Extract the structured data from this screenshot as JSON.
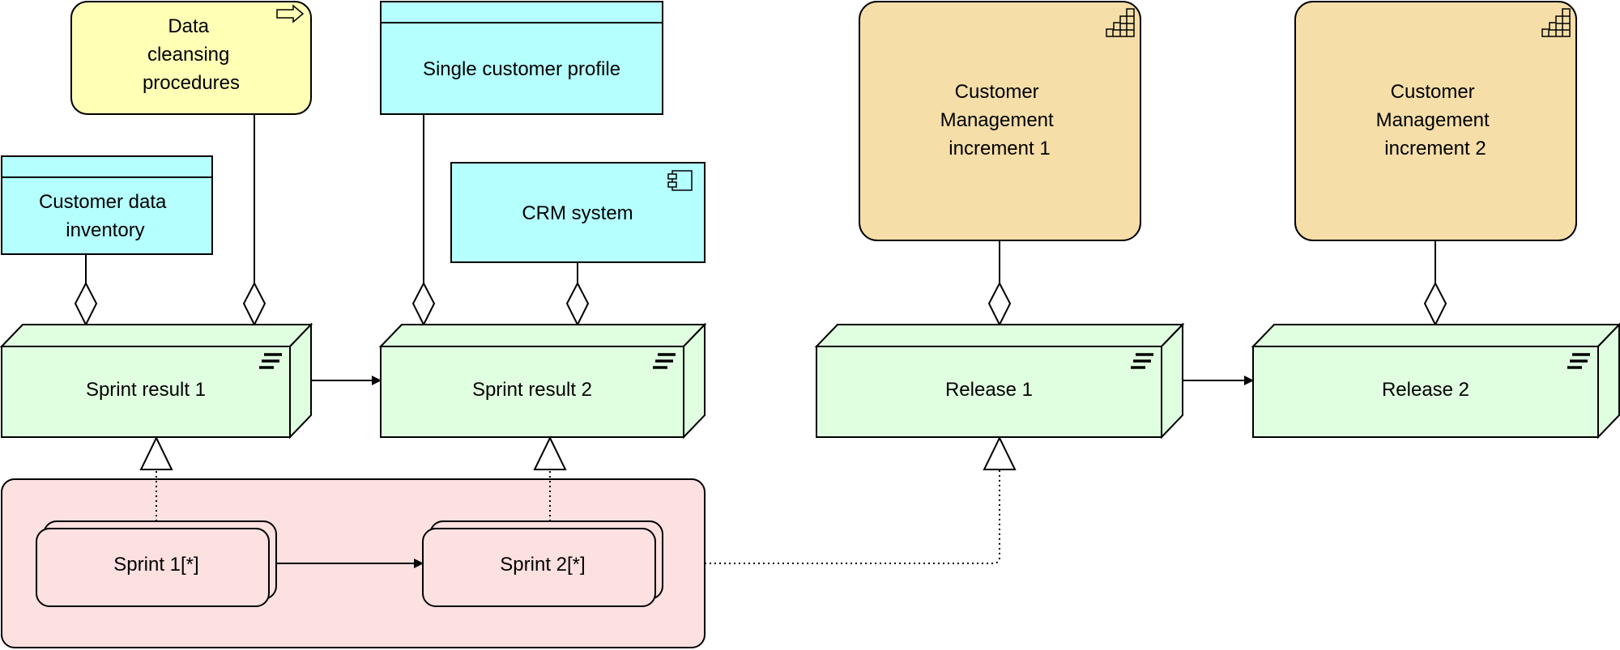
{
  "colors": {
    "work_package": "#ffffb5",
    "data_object": "#b5ffff",
    "application_component": "#b5ffff",
    "plateau": "#f5dea8",
    "deliverable_node": "#e0ffe0",
    "group": "#fde0e0"
  },
  "elements": {
    "data_cleansing": {
      "lines": [
        "Data",
        "cleansing",
        "procedures"
      ],
      "icon": "arrow-right-icon"
    },
    "single_customer_profile": {
      "label": "Single customer profile"
    },
    "customer_data_inventory": {
      "lines": [
        "Customer data",
        "inventory"
      ]
    },
    "crm_system": {
      "label": "CRM system",
      "icon": "component-icon"
    },
    "cm_increment_1": {
      "lines": [
        "Customer",
        "Management",
        "increment 1"
      ],
      "icon": "stairs-icon"
    },
    "cm_increment_2": {
      "lines": [
        "Customer",
        "Management",
        "increment 2"
      ],
      "icon": "stairs-icon"
    },
    "sprint_result_1": {
      "label": "Sprint result 1",
      "icon": "deliverable-icon"
    },
    "sprint_result_2": {
      "label": "Sprint result 2",
      "icon": "deliverable-icon"
    },
    "release_1": {
      "label": "Release 1",
      "icon": "deliverable-icon"
    },
    "release_2": {
      "label": "Release 2",
      "icon": "deliverable-icon"
    },
    "sprint_1": {
      "label": "Sprint 1[*]"
    },
    "sprint_2": {
      "label": "Sprint 2[*]"
    }
  }
}
